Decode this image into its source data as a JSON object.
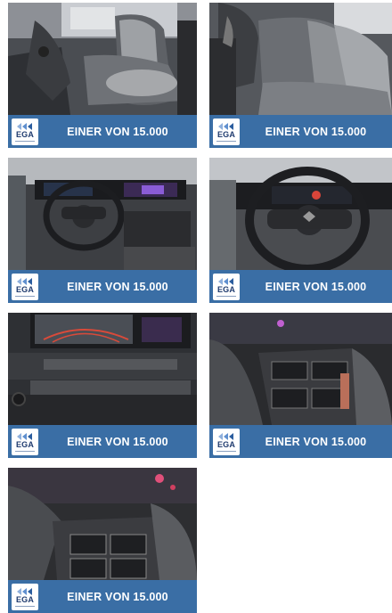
{
  "gallery": {
    "items": [
      {
        "name": "front-seats-photo",
        "banner": "EINER VON 15.000",
        "logo": "EGA"
      },
      {
        "name": "rear-seats-photo",
        "banner": "EINER VON 15.000",
        "logo": "EGA"
      },
      {
        "name": "dashboard-photo",
        "banner": "EINER VON 15.000",
        "logo": "EGA"
      },
      {
        "name": "steering-wheel-photo",
        "banner": "EINER VON 15.000",
        "logo": "EGA"
      },
      {
        "name": "camera-display-photo",
        "banner": "EINER VON 15.000",
        "logo": "EGA"
      },
      {
        "name": "wheel-right-controls-photo",
        "banner": "EINER VON 15.000",
        "logo": "EGA"
      },
      {
        "name": "wheel-left-controls-photo",
        "banner": "EINER VON 15.000",
        "logo": "EGA"
      }
    ]
  },
  "colors": {
    "banner": "#3a6ea5",
    "logo_text": "#1e3a6e",
    "logo_arrow_light": "#8fb0dc",
    "logo_arrow_dark": "#2b5d9e"
  }
}
